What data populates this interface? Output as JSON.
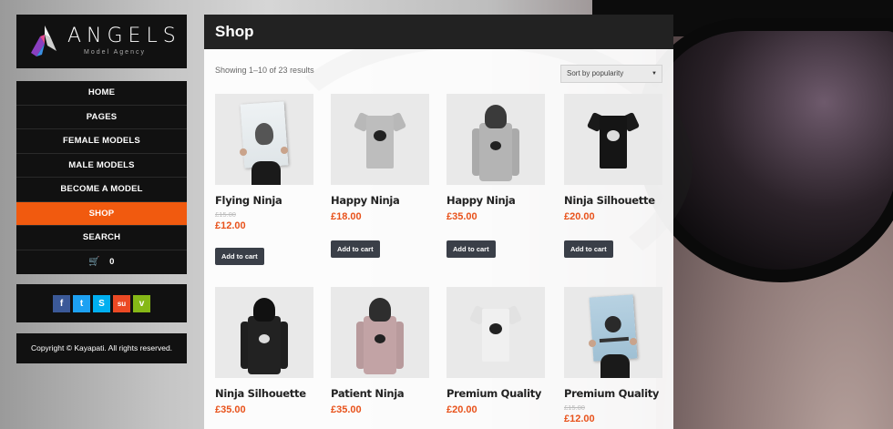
{
  "brand": {
    "name": "Angels",
    "tagline": "Model Agency"
  },
  "menu": {
    "items": [
      {
        "label": "HOME"
      },
      {
        "label": "PAGES"
      },
      {
        "label": "FEMALE MODELS"
      },
      {
        "label": "MALE MODELS"
      },
      {
        "label": "BECOME A MODEL"
      },
      {
        "label": "SHOP"
      },
      {
        "label": "SEARCH"
      }
    ],
    "active_index": 5,
    "cart_count": "0",
    "cart_icon": "cart-icon"
  },
  "social": [
    {
      "icon": "facebook-icon",
      "glyph": "f",
      "color": "#3b5998"
    },
    {
      "icon": "twitter-icon",
      "glyph": "t",
      "color": "#1da1f2"
    },
    {
      "icon": "skype-icon",
      "glyph": "S",
      "color": "#00aff0"
    },
    {
      "icon": "stumbleupon-icon",
      "glyph": "su",
      "color": "#eb4924"
    },
    {
      "icon": "vimeo-icon",
      "glyph": "v",
      "color": "#86b817"
    }
  ],
  "copyright": "Copyright © Kayapati. All rights reserved.",
  "page": {
    "title": "Shop",
    "result_count": "Showing 1–10 of 23 results",
    "sort_value": "Sort by popularity"
  },
  "colors": {
    "accent": "#f15a0f",
    "price": "#e8521b",
    "button": "#3a3f48"
  },
  "products": [
    {
      "name": "Flying Ninja",
      "old_price": "£15.00",
      "price": "£12.00",
      "button": "Add to cart",
      "kind": "poster"
    },
    {
      "name": "Happy Ninja",
      "old_price": "",
      "price": "£18.00",
      "button": "Add to cart",
      "kind": "tee-grey"
    },
    {
      "name": "Happy Ninja",
      "old_price": "",
      "price": "£35.00",
      "button": "Add to cart",
      "kind": "hoodie-grey"
    },
    {
      "name": "Ninja Silhouette",
      "old_price": "",
      "price": "£20.00",
      "button": "Add to cart",
      "kind": "tee-black"
    },
    {
      "name": "Ninja Silhouette",
      "old_price": "",
      "price": "£35.00",
      "button": "",
      "kind": "hoodie-black"
    },
    {
      "name": "Patient Ninja",
      "old_price": "",
      "price": "£35.00",
      "button": "",
      "kind": "hoodie-pink"
    },
    {
      "name": "Premium Quality",
      "old_price": "",
      "price": "£20.00",
      "button": "",
      "kind": "tee-white"
    },
    {
      "name": "Premium Quality",
      "old_price": "£15.00",
      "price": "£12.00",
      "button": "",
      "kind": "poster-blue"
    }
  ]
}
